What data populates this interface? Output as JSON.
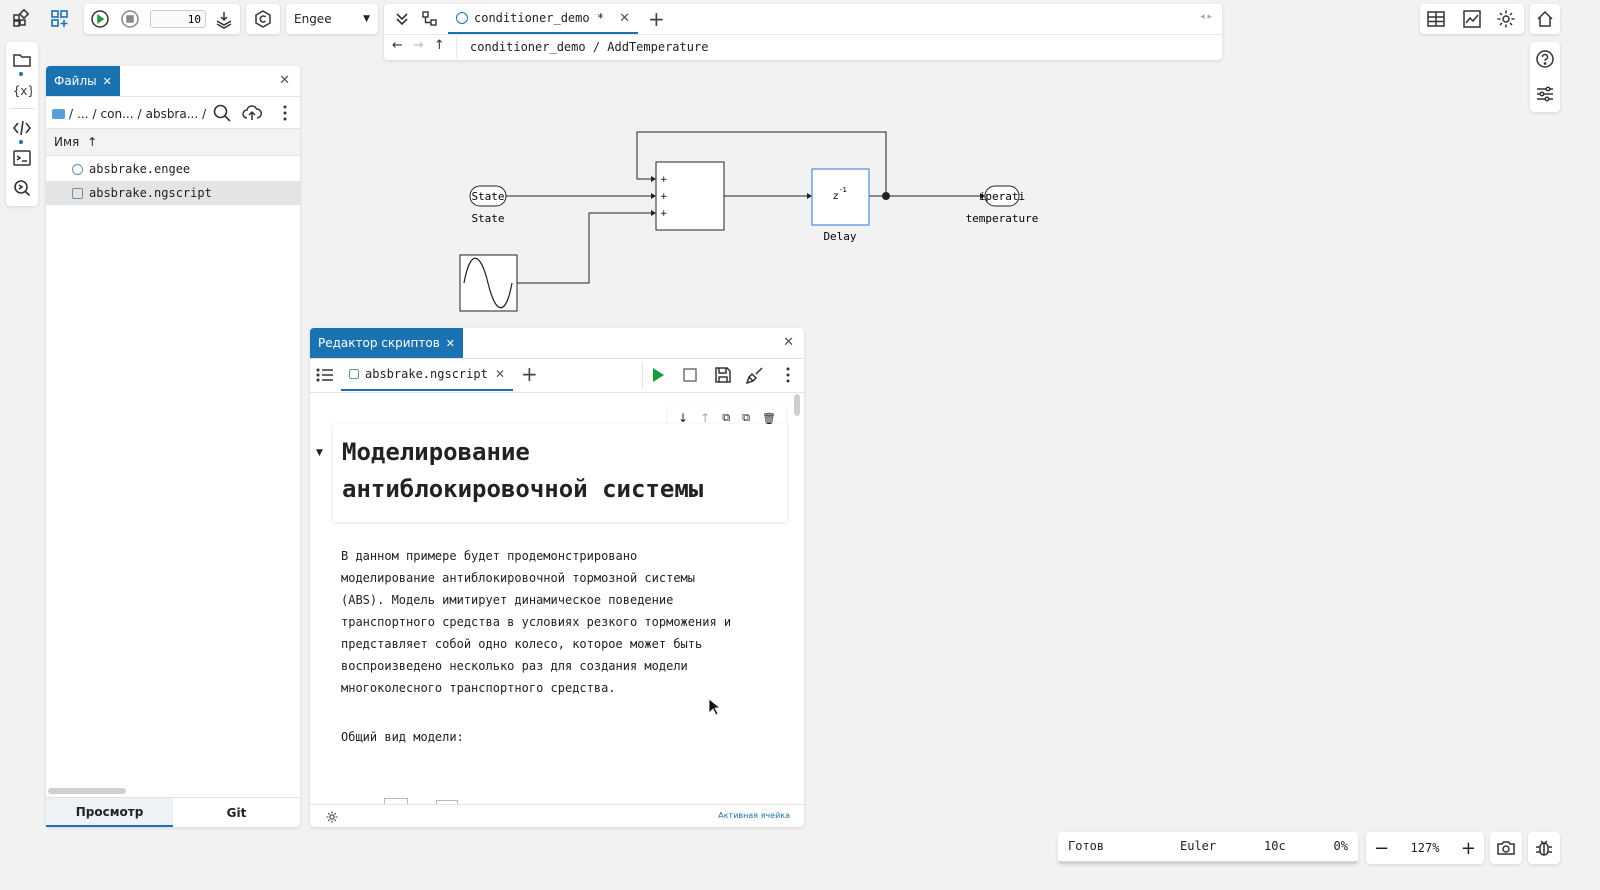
{
  "toolbar": {
    "steps_value": "10",
    "engine_select": "Engee",
    "colors": {
      "accent": "#1a73b0",
      "run": "#1a9c3a"
    }
  },
  "editor_tabs": {
    "active_tab": "conditioner_demo *",
    "breadcrumb": "conditioner_demo / AddTemperature"
  },
  "files_panel": {
    "tab_label": "Файлы",
    "path": {
      "root": "/",
      "ellipsis": "...",
      "seg1": "con...",
      "seg2": "absbra...",
      "end": "/"
    },
    "column_name": "Имя",
    "files": [
      {
        "name": "absbrake.engee",
        "icon": "engee-model-icon"
      },
      {
        "name": "absbrake.ngscript",
        "icon": "script-file-icon"
      }
    ],
    "bottom_tabs": {
      "view": "Просмотр",
      "git": "Git"
    }
  },
  "diagram": {
    "state_port": "State",
    "state_label": "State",
    "delay_symbol": "z",
    "delay_exp": "-1",
    "delay_label": "Delay",
    "out_port": "iperati",
    "out_label": "temperature",
    "sum_signs": [
      "+",
      "+",
      "+"
    ]
  },
  "script_editor": {
    "panel_title": "Редактор скриптов",
    "file_tab": "absbrake.ngscript",
    "heading": "Моделирование антиблокировочной системы",
    "paragraph_lines": [
      "В данном примере будет продемонстрировано",
      "моделирование антиблокировочной тормозной системы",
      "(ABS). Модель имитирует динамическое поведение",
      "транспортного средства в условиях резкого торможения и",
      "представляет собой одно колесо, которое может быть",
      "воспроизведено несколько раз для создания модели",
      "многоколесного транспортного средства."
    ],
    "subheading": "Общий вид модели:",
    "status_right": "Активная ячейка"
  },
  "statusbar": {
    "state": "Готов",
    "solver": "Euler",
    "time": "10с",
    "progress": "0%",
    "zoom": "127%"
  }
}
